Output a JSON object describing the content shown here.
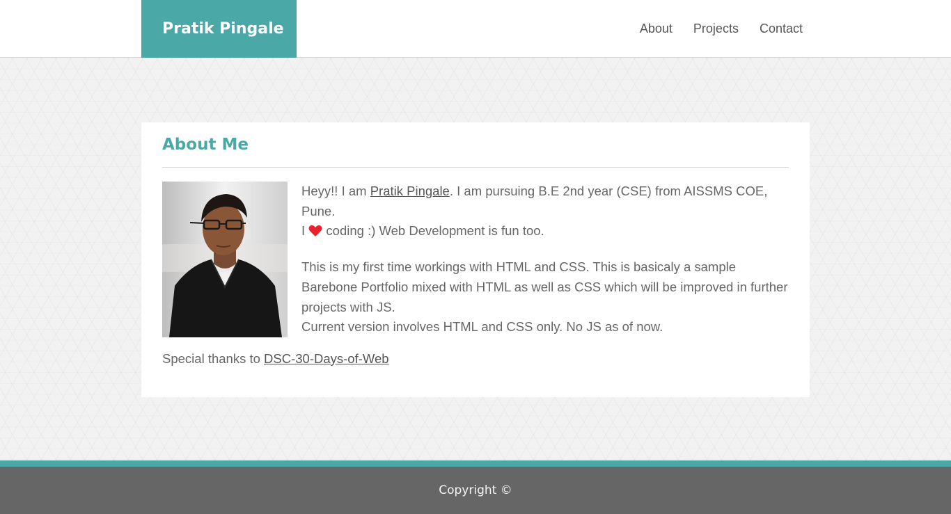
{
  "header": {
    "brand": "Pratik Pingale",
    "nav": [
      {
        "label": "About"
      },
      {
        "label": "Projects"
      },
      {
        "label": "Contact"
      }
    ]
  },
  "about": {
    "title": "About Me",
    "photo_icon": "profile-photo",
    "para1": {
      "prefix": "Heyy!! I am ",
      "name_link": "Pratik Pingale",
      "suffix": ". I am pursuing B.E 2nd year (CSE) from AISSMS COE, Pune.",
      "line2_prefix": "I ",
      "heart_icon": "heart-icon",
      "line2_suffix": " coding :) Web Development is fun too."
    },
    "para2": {
      "line1": "This is my first time workings with HTML and CSS. This is basicaly a sample Barebone Portfolio mixed with HTML as well as CSS which will be improved in further projects with JS.",
      "line2": "Current version involves HTML and CSS only. No JS as of now."
    },
    "thanks": {
      "prefix": "Special thanks to ",
      "link": "DSC-30-Days-of-Web"
    }
  },
  "footer": {
    "copyright": "Copyright ©"
  },
  "colors": {
    "accent": "#4aa9a7",
    "footer_bg": "#666666",
    "text": "#666666",
    "heart": "#e8232f"
  }
}
